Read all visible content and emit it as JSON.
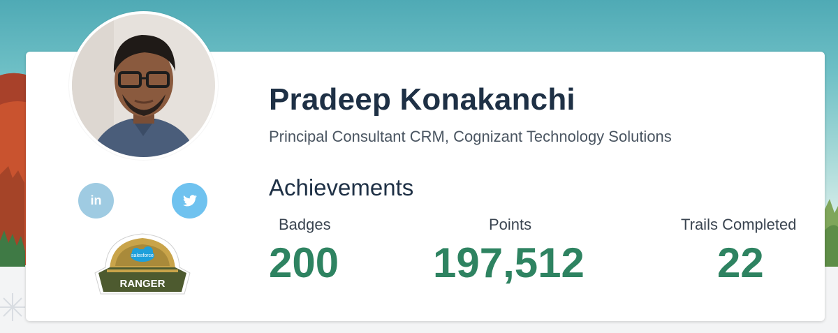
{
  "profile": {
    "name": "Pradeep Konakanchi",
    "title": "Principal Consultant CRM, Cognizant Technology Solutions"
  },
  "social": {
    "linkedin_label": "in"
  },
  "rank": {
    "brand": "salesforce",
    "label": "RANGER"
  },
  "achievements": {
    "heading": "Achievements",
    "stats": [
      {
        "label": "Badges",
        "value": "200"
      },
      {
        "label": "Points",
        "value": "197,512"
      },
      {
        "label": "Trails Completed",
        "value": "22"
      }
    ]
  },
  "colors": {
    "name": "#1e3045",
    "stat_value": "#2e8361",
    "linkedin": "#9fcbe2",
    "twitter": "#6fc2ef"
  },
  "icons": [
    "avatar-photo",
    "linkedin-icon",
    "twitter-icon",
    "ranger-badge-icon",
    "snowflake-icon"
  ]
}
